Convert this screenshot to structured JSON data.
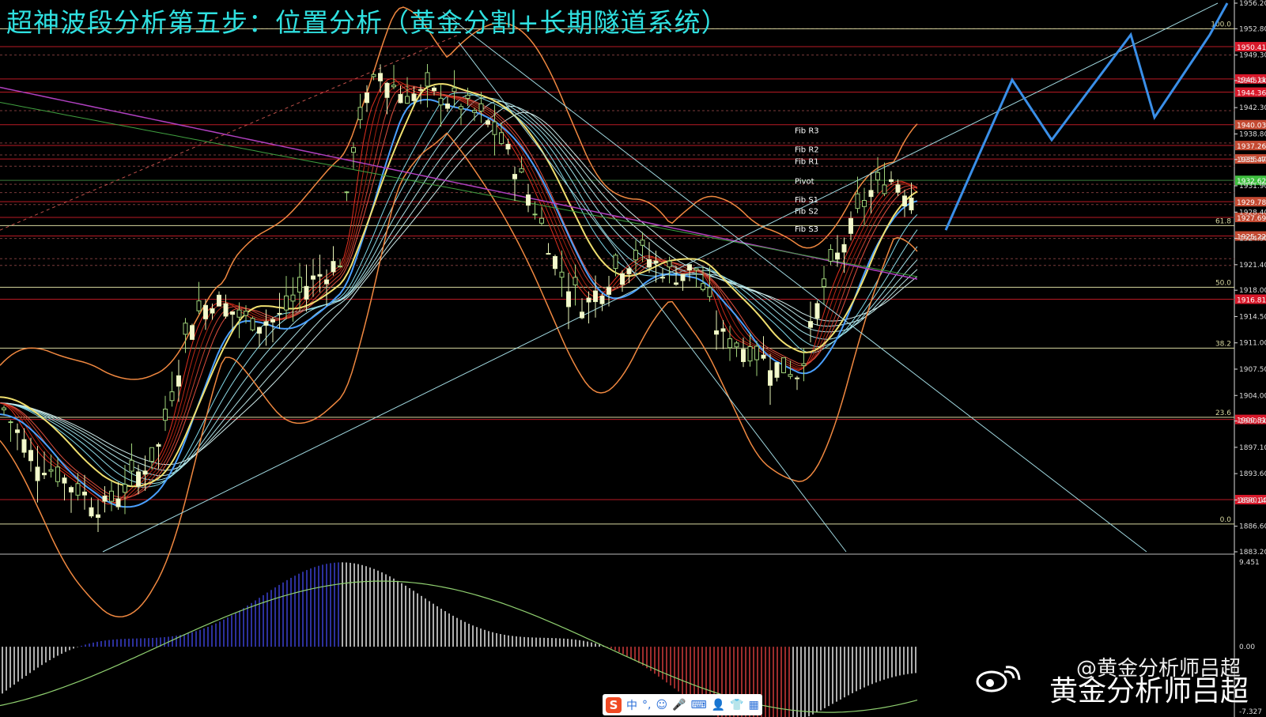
{
  "title": "超神波段分析第五步：位置分析（黄金分割+长期隧道系统）",
  "watermark": {
    "handle": "@黄金分析师吕超",
    "name": "黄金分析师吕超"
  },
  "ime_toolbar": {
    "logo": "S",
    "items": [
      "中",
      "°,",
      "☺",
      "🎤",
      "⌨",
      "👤",
      "👕",
      "▦"
    ]
  },
  "chart_data": [
    {
      "type": "candlestick",
      "name": "price",
      "ylim": [
        1883.2,
        1956.2
      ],
      "axis_ticks": [
        "1956.20",
        "1952.80",
        "1949.30",
        "1945.90",
        "1942.30",
        "1938.80",
        "1935.40",
        "1931.90",
        "1928.40",
        "1924.90",
        "1921.40",
        "1918.00",
        "1914.50",
        "1911.00",
        "1907.50",
        "1904.00",
        "1900.60",
        "1897.10",
        "1893.60",
        "1890.10",
        "1886.60",
        "1883.20"
      ],
      "price_tags": [
        {
          "value": "1950.41",
          "color": "#d8182a"
        },
        {
          "value": "1946.11",
          "color": "#d8182a"
        },
        {
          "value": "1944.36",
          "color": "#d8182a"
        },
        {
          "value": "1940.03",
          "color": "#c44a32"
        },
        {
          "value": "1937.26",
          "color": "#c44a32"
        },
        {
          "value": "1935.47",
          "color": "#c44a32"
        },
        {
          "value": "1932.62",
          "color": "#3fbf3f"
        },
        {
          "value": "1929.78",
          "color": "#c44a32"
        },
        {
          "value": "1927.69",
          "color": "#c44a32"
        },
        {
          "value": "1925.22",
          "color": "#c44a32"
        },
        {
          "value": "1916.81",
          "color": "#d8182a"
        },
        {
          "value": "1900.81",
          "color": "#d8182a"
        },
        {
          "value": "1890.14",
          "color": "#d8182a"
        }
      ],
      "fibonacci": [
        {
          "label": "100.0",
          "value": 1952.8
        },
        {
          "label": "61.8",
          "value": 1926.6
        },
        {
          "label": "50.0",
          "value": 1918.4
        },
        {
          "label": "38.2",
          "value": 1910.3
        },
        {
          "label": "23.6",
          "value": 1901.1
        },
        {
          "label": "0.0",
          "value": 1886.9
        }
      ],
      "pivot_labels": [
        "Fib R3",
        "Fib R2",
        "Fib R1",
        "Pivot",
        "Fib S1",
        "Fib S2",
        "Fib S3"
      ],
      "projection": "blue path: rising zig-zag from 1926 toward 1956"
    },
    {
      "type": "bar",
      "name": "oscillator",
      "ylim": [
        -7.327,
        9.451
      ],
      "axis_ticks": [
        "9.451",
        "0.00",
        "-7.327"
      ]
    }
  ]
}
